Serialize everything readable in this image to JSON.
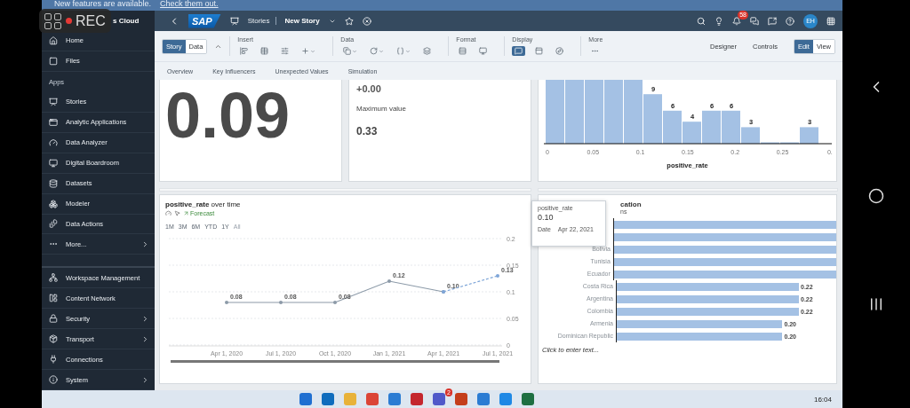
{
  "recorder": {
    "label": "REC"
  },
  "banner": {
    "text": "New features are available.",
    "link": "Check them out."
  },
  "sidebar": {
    "title": "s Cloud",
    "groups": [
      {
        "items": [
          {
            "label": "Home",
            "expandable": false
          },
          {
            "label": "Files",
            "expandable": false
          }
        ]
      },
      {
        "heading": "Apps",
        "items": [
          {
            "label": "Stories",
            "expandable": false
          },
          {
            "label": "Analytic Applications",
            "expandable": false
          },
          {
            "label": "Data Analyzer",
            "expandable": false
          },
          {
            "label": "Digital Boardroom",
            "expandable": false
          },
          {
            "label": "Datasets",
            "expandable": false
          },
          {
            "label": "Modeler",
            "expandable": false
          },
          {
            "label": "Data Actions",
            "expandable": false
          },
          {
            "label": "More...",
            "expandable": true
          }
        ]
      },
      {
        "items": [
          {
            "label": "Workspace Management",
            "expandable": false
          },
          {
            "label": "Content Network",
            "expandable": false
          },
          {
            "label": "Security",
            "expandable": true
          },
          {
            "label": "Transport",
            "expandable": true
          },
          {
            "label": "Connections",
            "expandable": false
          },
          {
            "label": "System",
            "expandable": true
          }
        ]
      }
    ]
  },
  "header": {
    "logo": "SAP",
    "breadcrumb": "Stories",
    "story_title": "New Story",
    "notifications": "58",
    "avatar": "EH"
  },
  "toolbar": {
    "modes": [
      {
        "label": "Story",
        "selected": true
      },
      {
        "label": "Data",
        "selected": false
      }
    ],
    "groups": [
      {
        "title": "Insert",
        "tools": [
          {
            "selected": false,
            "dropdown": false
          },
          {
            "selected": false,
            "dropdown": false
          },
          {
            "selected": false,
            "dropdown": false
          },
          {
            "selected": false,
            "dropdown": true
          }
        ]
      },
      {
        "title": "Data",
        "tools": [
          {
            "selected": false,
            "dropdown": true
          },
          {
            "selected": false,
            "dropdown": true
          },
          {
            "selected": false,
            "dropdown": true
          },
          {
            "selected": false,
            "dropdown": false
          }
        ]
      },
      {
        "title": "Format",
        "tools": [
          {
            "selected": false,
            "dropdown": false
          },
          {
            "selected": false,
            "dropdown": false
          }
        ]
      },
      {
        "title": "Display",
        "tools": [
          {
            "selected": true,
            "dropdown": false
          },
          {
            "selected": false,
            "dropdown": false
          },
          {
            "selected": false,
            "dropdown": false
          }
        ]
      },
      {
        "title": "More",
        "tools": [
          {
            "selected": false,
            "dropdown": false
          }
        ]
      }
    ],
    "views": [
      "Designer",
      "Controls"
    ],
    "edit_modes": [
      {
        "label": "Edit",
        "selected": true
      },
      {
        "label": "View",
        "selected": false
      }
    ]
  },
  "page_tabs": [
    "Overview",
    "Key Influencers",
    "Unexpected Values",
    "Simulation"
  ],
  "kpi": {
    "value": "0.09"
  },
  "stats": {
    "delta": "+0.00",
    "label": "Maximum value",
    "value": "0.33"
  },
  "histogram": {
    "title": "positive_rate",
    "xticks": [
      "0",
      "0.05",
      "0.1",
      "0.15",
      "0.2",
      "0.25",
      "0."
    ],
    "bars": [
      {
        "clipped": true
      },
      {
        "clipped": true
      },
      {
        "clipped": true
      },
      {
        "clipped": true
      },
      {
        "clipped": true
      },
      {
        "clipped": false,
        "label": "9"
      },
      {
        "clipped": false,
        "label": "6"
      },
      {
        "clipped": false,
        "label": "4"
      },
      {
        "clipped": false,
        "label": "6"
      },
      {
        "clipped": false,
        "label": "6"
      },
      {
        "clipped": false,
        "label": "3"
      },
      {
        "clipped": false
      },
      {
        "clipped": false
      },
      {
        "clipped": false,
        "label": "3"
      }
    ]
  },
  "timeseries": {
    "title_rest": "over time",
    "ranges": [
      {
        "label": "1M",
        "selected": false
      },
      {
        "label": "3M",
        "selected": false
      },
      {
        "label": "6M",
        "selected": false
      },
      {
        "label": "YTD",
        "selected": false
      },
      {
        "label": "1Y",
        "selected": false
      },
      {
        "label": "All",
        "selected": true
      }
    ],
    "chart_data": {
      "type": "line",
      "categories": [
        "Apr 1, 2020",
        "Jul 1, 2020",
        "Oct 1, 2020",
        "Jan 1, 2021",
        "Apr 1, 2021",
        "Jul 1, 2021"
      ],
      "series": [
        {
          "name": "positive_rate",
          "color": "#8c9aa8",
          "line_style": "solid",
          "values": [
            0.08,
            0.08,
            0.08,
            0.12,
            0.1,
            null
          ],
          "value_labels": [
            "0.08",
            "0.08",
            "0.08",
            "0.12",
            "0.10",
            null
          ]
        },
        {
          "name": "Forecast",
          "color": "#7fa6d8",
          "line_style": "dashed",
          "values": [
            null,
            null,
            null,
            null,
            0.1,
            0.13
          ],
          "value_labels": [
            null,
            null,
            null,
            null,
            null,
            "0.13"
          ]
        }
      ],
      "ylim": [
        0,
        0.2
      ],
      "yticks": [
        0,
        0.05,
        0.1,
        0.15,
        0.2
      ],
      "grid": true
    }
  },
  "ranking": {
    "title": "cation",
    "subtitle": "ns",
    "rows": [
      {
        "clipped": true
      },
      {
        "clipped": true
      },
      {
        "category": "Bolivia",
        "clipped": true
      },
      {
        "category": "Tunisia",
        "clipped": true
      },
      {
        "category": "Ecuador",
        "clipped": true
      },
      {
        "category": "Costa Rica",
        "clipped": false,
        "value": "0.22"
      },
      {
        "category": "Argentina",
        "clipped": false,
        "value": "0.22"
      },
      {
        "category": "Colombia",
        "clipped": false,
        "value": "0.22"
      },
      {
        "category": "Armenia",
        "clipped": false,
        "value": "0.20"
      },
      {
        "category": "Dominican Republic",
        "clipped": false,
        "value": "0.20"
      }
    ],
    "placeholder": "Click to enter text..."
  },
  "tooltip": {
    "measure": "positive_rate",
    "value": "0.10",
    "key": "Date",
    "date": "Apr 22, 2021"
  },
  "taskbar": {
    "badge": "2",
    "time": "16:04"
  }
}
